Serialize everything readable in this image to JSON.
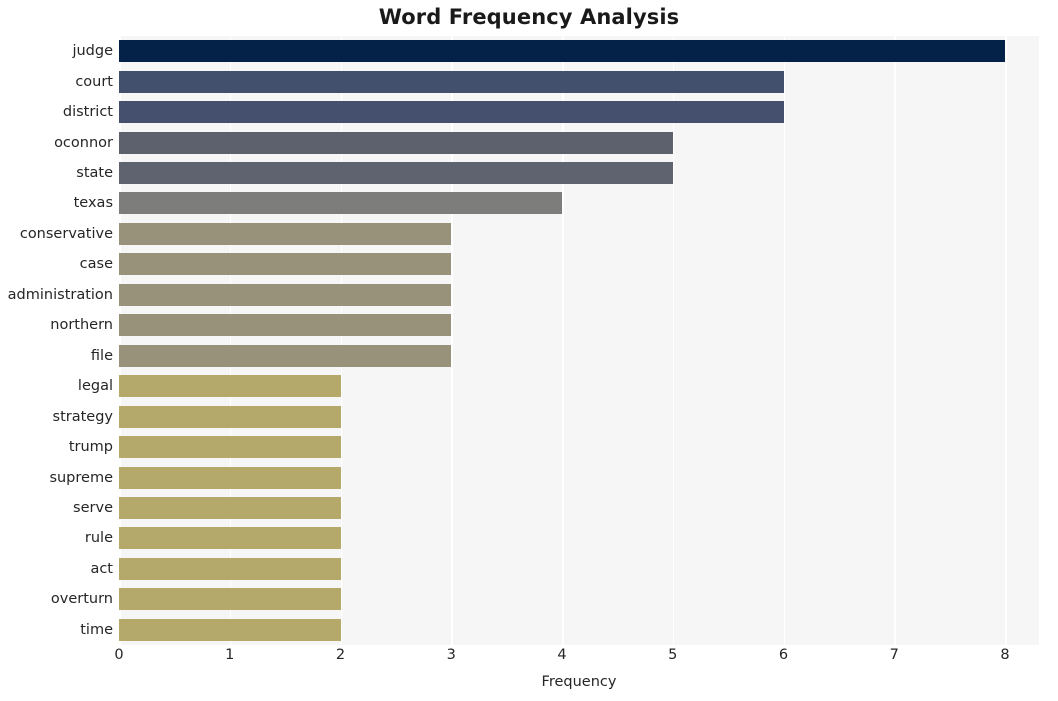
{
  "chart_data": {
    "type": "bar",
    "orientation": "horizontal",
    "title": "Word Frequency Analysis",
    "xlabel": "Frequency",
    "ylabel": "",
    "xlim": [
      0,
      8.3
    ],
    "xticks": [
      0,
      1,
      2,
      3,
      4,
      5,
      6,
      7,
      8
    ],
    "xtick_labels": [
      "0",
      "1",
      "2",
      "3",
      "4",
      "5",
      "6",
      "7",
      "8"
    ],
    "grid": true,
    "grid_axis": "x",
    "legend": false,
    "categories": [
      "judge",
      "court",
      "district",
      "oconnor",
      "state",
      "texas",
      "conservative",
      "case",
      "administration",
      "northern",
      "file",
      "legal",
      "strategy",
      "trump",
      "supreme",
      "serve",
      "rule",
      "act",
      "overturn",
      "time"
    ],
    "values": [
      8,
      6,
      6,
      5,
      5,
      4,
      3,
      3,
      3,
      3,
      3,
      2,
      2,
      2,
      2,
      2,
      2,
      2,
      2,
      2
    ],
    "bar_colors": [
      "#042248",
      "#424f6d",
      "#454f6e",
      "#5d616e",
      "#5f636f",
      "#7d7d7b",
      "#99927a",
      "#99927a",
      "#99927a",
      "#99927a",
      "#99927a",
      "#b4a86a",
      "#b4a86a",
      "#b4a86a",
      "#b4a86a",
      "#b4a86a",
      "#b4a86a",
      "#b4a86a",
      "#b4a86a",
      "#b4a86a"
    ],
    "plot_background": "#f6f6f7",
    "gridline_color": "#ffffff",
    "figure_background": "#ffffff"
  }
}
